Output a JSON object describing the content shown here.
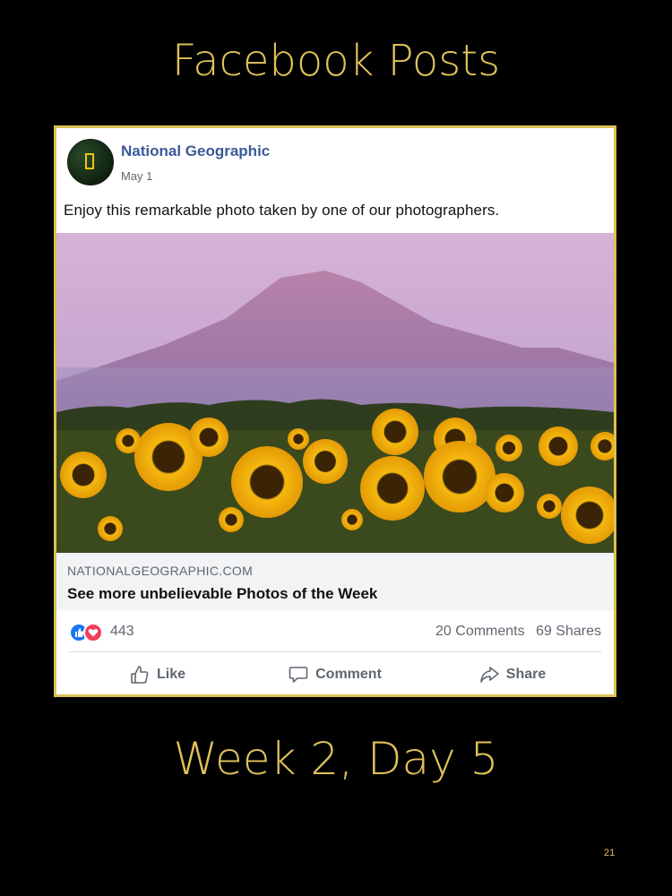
{
  "slide": {
    "title": "Facebook Posts",
    "day_label": "Week 2, Day 5",
    "page_number": "21"
  },
  "post": {
    "page_name": "National Geographic",
    "date": "May 1",
    "text": "Enjoy this remarkable photo taken by one of our photographers.",
    "link": {
      "domain": "NATIONALGEOGRAPHIC.COM",
      "title": "See more unbelievable Photos of the Week"
    },
    "reactions": {
      "count": "443",
      "icons": [
        "like-reaction-icon",
        "love-reaction-icon"
      ]
    },
    "comments": "20 Comments",
    "shares": "69 Shares",
    "actions": {
      "like": "Like",
      "comment": "Comment",
      "share": "Share"
    }
  },
  "colors": {
    "background": "#000000",
    "accent_gold": "#e0c25a",
    "facebook_blue": "#3b5998",
    "like_blue": "#1877f2",
    "love_red": "#f33e58"
  }
}
